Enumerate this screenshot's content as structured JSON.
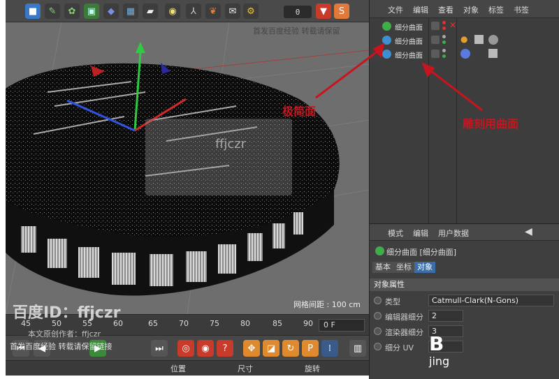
{
  "toolbar": {
    "frame_value": "0"
  },
  "viewport": {
    "grid_spacing": "网格间距 : 100 cm"
  },
  "timeline": {
    "ticks": [
      "45",
      "50",
      "55",
      "60",
      "65",
      "70",
      "75",
      "80",
      "85",
      "90"
    ],
    "frame_field": "0 F"
  },
  "coords": {
    "position": "位置",
    "size": "尺寸",
    "rotation": "旋转"
  },
  "object_manager": {
    "menu": [
      "文件",
      "编辑",
      "查看",
      "对象",
      "标签",
      "书签"
    ],
    "objects": [
      {
        "name": "细分曲面",
        "icon_color": "#3fae49"
      },
      {
        "name": "细分曲面",
        "icon_color": "#3f8fd0"
      },
      {
        "name": "细分曲面",
        "icon_color": "#3f8fd0"
      }
    ]
  },
  "attribute_manager": {
    "menu": [
      "模式",
      "编辑",
      "用户数据"
    ],
    "object_title": "细分曲面 [细分曲面]",
    "tabs": [
      {
        "label": "基本",
        "active": false
      },
      {
        "label": "坐标",
        "active": false
      },
      {
        "label": "对象",
        "active": true
      }
    ],
    "section": "对象属性",
    "properties": [
      {
        "label": "类型",
        "value": "Catmull-Clark(N-Gons)"
      },
      {
        "label": "编辑器细分",
        "value": "2"
      },
      {
        "label": "渲染器细分",
        "value": "3"
      },
      {
        "label": "细分 UV",
        "value": ""
      }
    ]
  },
  "annotations": {
    "left_label": "极简面",
    "right_label": "雕刻用曲面"
  },
  "watermarks": {
    "top": "首发百度经验 转载请保留",
    "center_id": "ffjczr",
    "bottom_id": "百度ID：ffjczr",
    "author": "本文原创作者：ffjczr",
    "publish": "首发百度经验 转载请保留链接",
    "corner_logo": "B",
    "corner_text": "jing"
  },
  "colors": {
    "accent_red": "#c8141e",
    "tab_active": "#3b6ea8"
  }
}
